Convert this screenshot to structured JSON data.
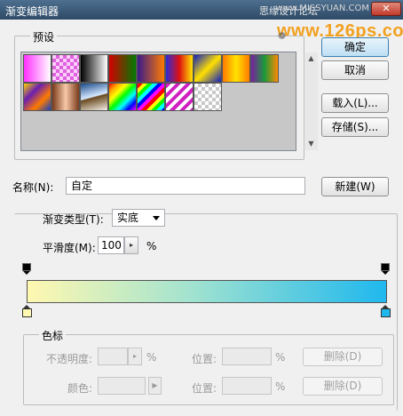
{
  "window": {
    "title": "渐变编辑器",
    "watermark_cn": "思缘设计论坛",
    "watermark_en": "www.MISSYUAN.COM",
    "close_glyph": "✕"
  },
  "url_watermark": "www.126ps.com",
  "presets": {
    "label": "预设",
    "menu_glyph": "❁",
    "scroll_up": "▲",
    "scroll_down": "▼",
    "swatches": [
      {
        "name": "foreground-background",
        "css": "linear-gradient(to right,#ff30ff,#ffffff)"
      },
      {
        "name": "foreground-transparent",
        "css": "repeating-conic-gradient(#e060e0 0% 25%, #fbd0fb 0% 50%) 0 0/8px 8px"
      },
      {
        "name": "black-white",
        "css": "linear-gradient(to right,#000,#fff)"
      },
      {
        "name": "red-green",
        "css": "linear-gradient(to right,#d40000,#007a00)"
      },
      {
        "name": "violet-orange",
        "css": "linear-gradient(to right,#3a1a8c,#ff7a00)"
      },
      {
        "name": "blue-red-yellow",
        "css": "linear-gradient(to right,#2b2bd9,#e01010,#ffe600)"
      },
      {
        "name": "blue-yellow-blue",
        "css": "linear-gradient(135deg,#1020c0 0%,#ffe000 50%,#1020c0 100%)"
      },
      {
        "name": "orange-yellow-orange",
        "css": "linear-gradient(to right,#ff7a00,#ffe400,#ff7a00)"
      },
      {
        "name": "violet-green-orange",
        "css": "linear-gradient(to right,#7a1fa2,#1a9a3a,#ff8a00)"
      },
      {
        "name": "yellow-violet-orange-blue",
        "css": "linear-gradient(135deg,#ffd200,#6a1fb0,#ff7a00,#1240c0)"
      },
      {
        "name": "copper",
        "css": "linear-gradient(to right,#7a3a1a,#f6c8a8,#7a3a1a)"
      },
      {
        "name": "chrome",
        "css": "linear-gradient(165deg,#1a4a8a 0%,#d8eaff 48%,#6a4a20 52%,#f4f0e8 100%)"
      },
      {
        "name": "spectrum",
        "css": "linear-gradient(135deg,red,orange,yellow,lime,cyan,blue,magenta)"
      },
      {
        "name": "transparent-rainbow",
        "css": "repeating-linear-gradient(135deg,#ff0000 0 4px,#ffff00 4px 8px,#00ff00 8px 12px,#00ffff 12px 16px,#0000ff 16px 20px,#ff00ff 20px 24px)"
      },
      {
        "name": "transparent-stripes",
        "css": "repeating-linear-gradient(135deg,#d020c0 0 4px,#ffffff 4px 8px)"
      },
      {
        "name": "checker-transparent",
        "css": "repeating-conic-gradient(#c8c8c8 0% 25%, #ffffff 0% 50%) 0 0/8px 8px"
      }
    ]
  },
  "buttons": {
    "ok": "确定",
    "cancel": "取消",
    "load": "载入(L)...",
    "save": "存储(S)...",
    "new": "新建(W)"
  },
  "name": {
    "label": "名称(N):",
    "value": "自定"
  },
  "gradient_type": {
    "label": "渐变类型(T):",
    "value": "实底"
  },
  "smoothness": {
    "label": "平滑度(M):",
    "value": "100",
    "unit": "%",
    "step_glyph": "▸"
  },
  "gradient": {
    "start_color": "#fff8b0",
    "mid_color": "#a3e3cf",
    "end_color": "#1fb8ee",
    "opacity_stop_color": "#000000"
  },
  "stops": {
    "label": "色标",
    "opacity_label": "不透明度:",
    "opacity_unit": "%",
    "location_label": "位置:",
    "location_unit": "%",
    "delete_label": "删除(D)",
    "color_label": "颜色:",
    "location2_label": "位置:",
    "location2_unit": "%",
    "delete2_label": "删除(D)",
    "step_glyph": "▸",
    "color_step_glyph": "▶"
  }
}
